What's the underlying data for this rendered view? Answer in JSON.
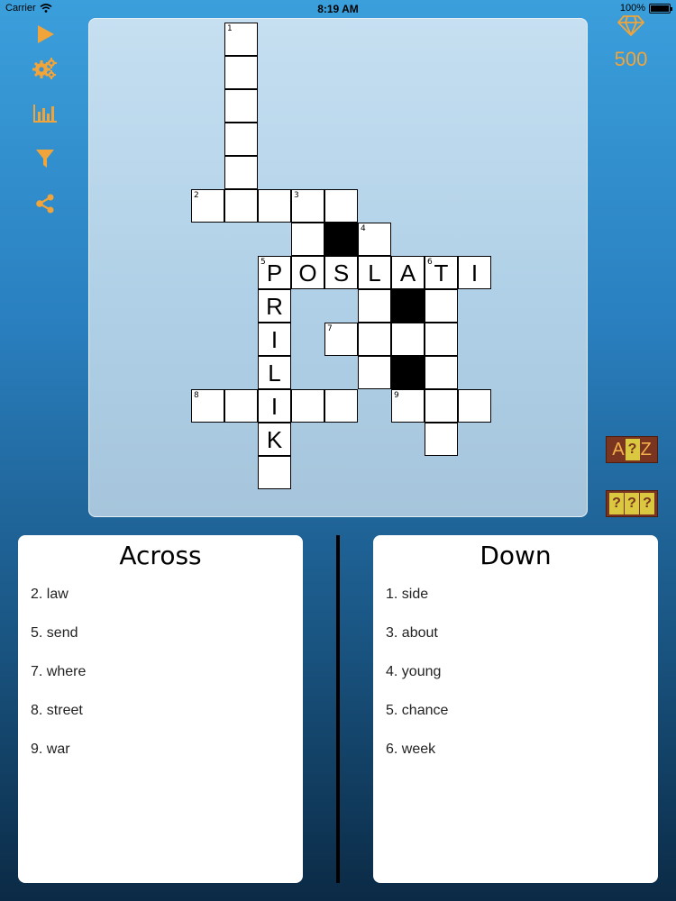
{
  "status": {
    "carrier": "Carrier",
    "time": "8:19 AM",
    "battery": "100%"
  },
  "toolbar": [
    {
      "name": "play-icon"
    },
    {
      "name": "settings-gears-icon"
    },
    {
      "name": "stats-chart-icon"
    },
    {
      "name": "filter-icon"
    },
    {
      "name": "share-icon"
    }
  ],
  "gems": {
    "count": "500",
    "icon": "diamond-icon"
  },
  "puzzle": {
    "size": 15,
    "cells": [
      {
        "r": 0,
        "c": 4,
        "num": "1"
      },
      {
        "r": 1,
        "c": 4
      },
      {
        "r": 2,
        "c": 4
      },
      {
        "r": 3,
        "c": 4
      },
      {
        "r": 4,
        "c": 4
      },
      {
        "r": 5,
        "c": 3,
        "num": "2"
      },
      {
        "r": 5,
        "c": 4
      },
      {
        "r": 5,
        "c": 5
      },
      {
        "r": 5,
        "c": 6,
        "num": "3"
      },
      {
        "r": 5,
        "c": 7
      },
      {
        "r": 6,
        "c": 6
      },
      {
        "r": 6,
        "c": 7,
        "black": true
      },
      {
        "r": 6,
        "c": 8,
        "num": "4"
      },
      {
        "r": 7,
        "c": 5,
        "num": "5",
        "letter": "P"
      },
      {
        "r": 7,
        "c": 6,
        "letter": "O"
      },
      {
        "r": 7,
        "c": 7,
        "letter": "S"
      },
      {
        "r": 7,
        "c": 8,
        "letter": "L"
      },
      {
        "r": 7,
        "c": 9,
        "letter": "A"
      },
      {
        "r": 7,
        "c": 10,
        "num": "6",
        "letter": "T"
      },
      {
        "r": 7,
        "c": 11,
        "letter": "I"
      },
      {
        "r": 8,
        "c": 5,
        "letter": "R"
      },
      {
        "r": 8,
        "c": 8
      },
      {
        "r": 8,
        "c": 9,
        "black": true
      },
      {
        "r": 8,
        "c": 10
      },
      {
        "r": 9,
        "c": 5,
        "letter": "I"
      },
      {
        "r": 9,
        "c": 7,
        "num": "7"
      },
      {
        "r": 9,
        "c": 8
      },
      {
        "r": 9,
        "c": 9
      },
      {
        "r": 9,
        "c": 10
      },
      {
        "r": 10,
        "c": 5,
        "letter": "L"
      },
      {
        "r": 10,
        "c": 8
      },
      {
        "r": 10,
        "c": 9,
        "black": true
      },
      {
        "r": 10,
        "c": 10
      },
      {
        "r": 11,
        "c": 3,
        "num": "8"
      },
      {
        "r": 11,
        "c": 4
      },
      {
        "r": 11,
        "c": 5,
        "letter": "I"
      },
      {
        "r": 11,
        "c": 6
      },
      {
        "r": 11,
        "c": 7
      },
      {
        "r": 11,
        "c": 9,
        "num": "9"
      },
      {
        "r": 11,
        "c": 10
      },
      {
        "r": 11,
        "c": 11
      },
      {
        "r": 12,
        "c": 5,
        "letter": "K"
      },
      {
        "r": 12,
        "c": 10
      },
      {
        "r": 13,
        "c": 5
      }
    ]
  },
  "hints": {
    "letter_hint": {
      "left": "A",
      "mid": "?",
      "right": "Z"
    },
    "word_hint": {
      "marks": [
        "?",
        "?",
        "?"
      ]
    }
  },
  "across": {
    "title": "Across",
    "clues": [
      "2. law",
      "5. send",
      "7. where",
      "8. street",
      "9. war"
    ]
  },
  "down": {
    "title": "Down",
    "clues": [
      "1. side",
      "3. about",
      "4. young",
      "5. chance",
      "6. week"
    ]
  },
  "colors": {
    "accent": "#f0a43a",
    "hint_bg": "#7a3520",
    "hint_box": "#d9c840"
  }
}
